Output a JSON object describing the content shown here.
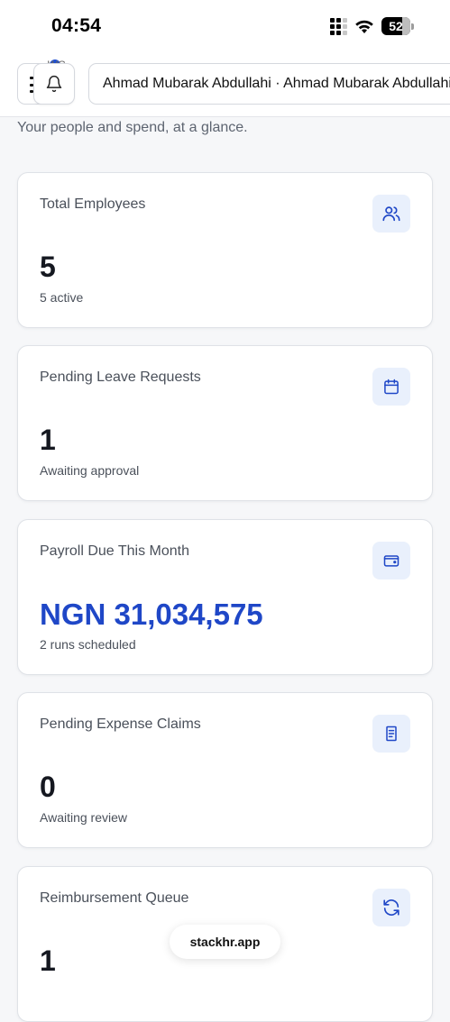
{
  "status_bar": {
    "time": "04:54",
    "battery_percent": "52",
    "battery_level": 0.52
  },
  "header": {
    "brand_peek": "WC",
    "user_label": "Ahmad Mubarak Abdullahi · Ahmad Mubarak Abdullahi"
  },
  "page": {
    "subtitle": "Your people and spend, at a glance."
  },
  "cards": [
    {
      "label": "Total Employees",
      "value": "5",
      "note": "5 active",
      "icon": "users-icon"
    },
    {
      "label": "Pending Leave Requests",
      "value": "1",
      "note": "Awaiting approval",
      "icon": "calendar-icon"
    },
    {
      "label": "Payroll Due This Month",
      "value": "NGN 31,034,575",
      "note": "2 runs scheduled",
      "icon": "wallet-icon"
    },
    {
      "label": "Pending Expense Claims",
      "value": "0",
      "note": "Awaiting review",
      "icon": "receipt-icon"
    },
    {
      "label": "Reimbursement Queue",
      "value": "1",
      "note": "",
      "icon": "refresh-icon"
    }
  ],
  "browser": {
    "url": "stackhr.app"
  },
  "colors": {
    "accent": "#1f47c7",
    "icon_bg": "#e9f0fc",
    "card_border": "#dfe2e7"
  }
}
